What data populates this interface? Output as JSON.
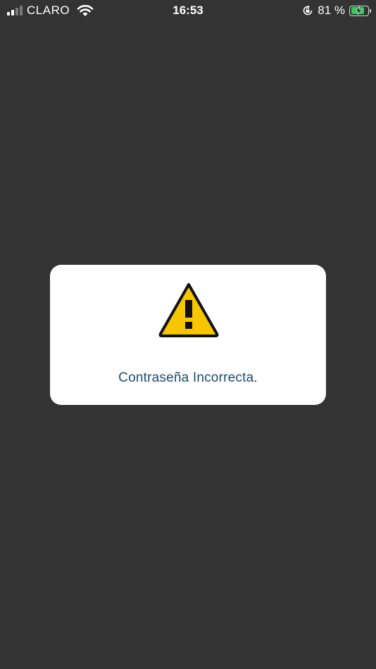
{
  "status_bar": {
    "carrier": "CLARO",
    "time": "16:53",
    "battery_percent": "81 %",
    "signal_bars_filled": 2,
    "signal_bars_total": 4,
    "battery_level": 0.81,
    "charging": true,
    "icons": [
      "signal-icon",
      "wifi-icon",
      "orientation-lock-icon",
      "battery-icon"
    ]
  },
  "dialog": {
    "icon": "warning-icon",
    "icon_color": "#f7c600",
    "message": "Contraseña Incorrecta."
  },
  "colors": {
    "background": "#333333",
    "dialog_background": "#ffffff",
    "message_text": "#1f4b6e",
    "battery_fill": "#34c759"
  }
}
